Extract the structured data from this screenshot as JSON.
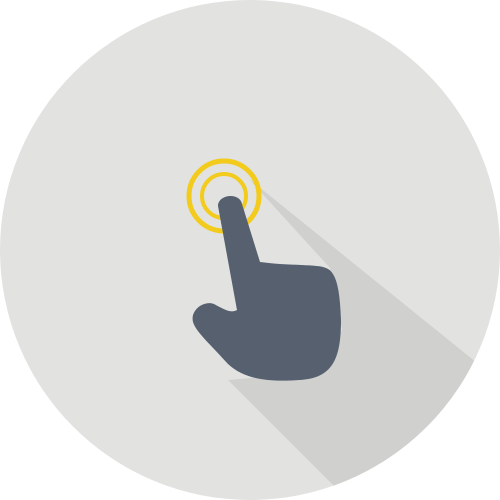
{
  "icon": {
    "name": "tap-gesture-icon",
    "colors": {
      "background_circle": "#E2E3E1",
      "long_shadow": "#D0D1CF",
      "hand": "#56606F",
      "ripple": "#F2CB1C"
    }
  }
}
